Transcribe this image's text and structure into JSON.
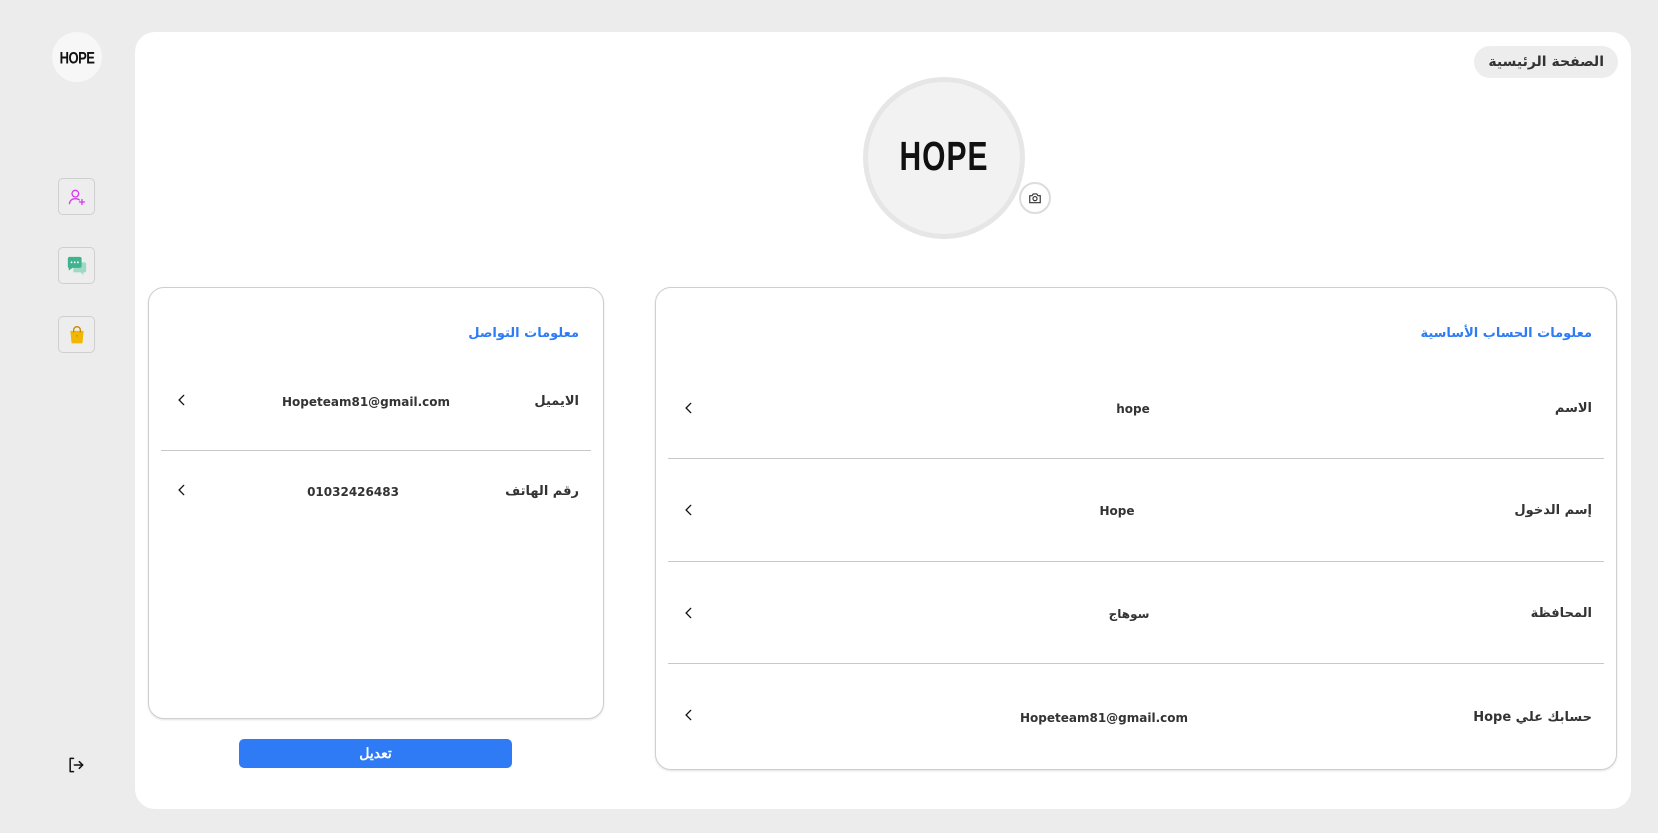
{
  "sidebar": {
    "logo_text": "HOPE",
    "items": [
      {
        "icon": "add-user-icon",
        "color": "#d63af0"
      },
      {
        "icon": "chat-icon",
        "color": "#3fb28f"
      },
      {
        "icon": "shopping-bag-icon",
        "color": "#f2b705"
      }
    ],
    "logout_icon": "logout-icon"
  },
  "header": {
    "home_label": "الصفحة الرئيسية"
  },
  "profile": {
    "avatar_text": "HOPE",
    "camera_icon": "camera-icon"
  },
  "contact": {
    "title": "معلومات التواصل",
    "rows": [
      {
        "label": "الايميل",
        "value": "Hopeteam81@gmail.com"
      },
      {
        "label": "رقم الهاتف",
        "value": "01032426483"
      }
    ],
    "edit_label": "تعديل"
  },
  "account": {
    "title": "معلومات الحساب الأساسية",
    "rows": [
      {
        "label": "الاسم",
        "value": "hope"
      },
      {
        "label": "إسم الدخول",
        "value": "Hope"
      },
      {
        "label": "المحافظة",
        "value": "سوهاج"
      },
      {
        "label": "حسابك علي Hope",
        "value": "Hopeteam81@gmail.com"
      }
    ]
  },
  "colors": {
    "accent": "#2f7bf5",
    "background": "#ececec"
  }
}
